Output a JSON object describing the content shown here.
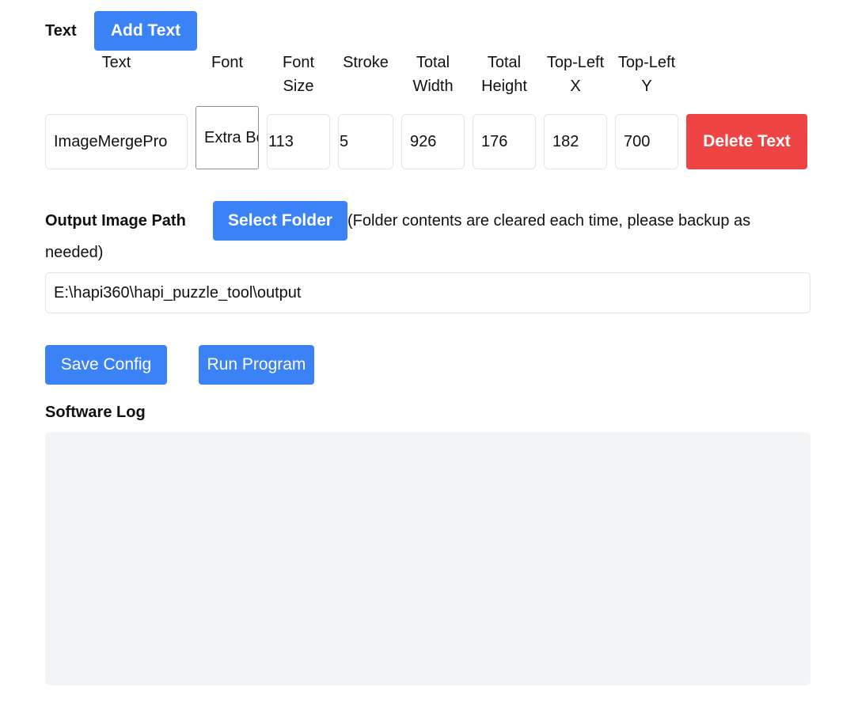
{
  "text_section": {
    "label": "Text",
    "add_button": "Add Text",
    "columns": [
      "Text",
      "Font",
      "Font\nSize",
      "Stroke",
      "Total\nWidth",
      "Total\nHeight",
      "Top-Left\nX",
      "Top-Left\nY"
    ],
    "row": {
      "text": "ImageMergePro",
      "font": "Extra Bold",
      "font_size": "113",
      "stroke": "5",
      "total_width": "926",
      "total_height": "176",
      "top_left_x": "182",
      "top_left_y": "700",
      "delete_button": "Delete Text"
    }
  },
  "output": {
    "label": "Output Image Path",
    "select_button": "Select Folder",
    "note_line1": "(Folder contents are cleared each time, please backup as",
    "note_line2": "needed)",
    "path_value": "E:\\hapi360\\hapi_puzzle_tool\\output"
  },
  "actions": {
    "save_config": "Save Config",
    "run_program": "Run Program"
  },
  "log": {
    "label": "Software Log",
    "content": ""
  },
  "colors": {
    "primary": "#3b82f6",
    "danger": "#ef4444",
    "log_background": "#f3f4f6"
  }
}
